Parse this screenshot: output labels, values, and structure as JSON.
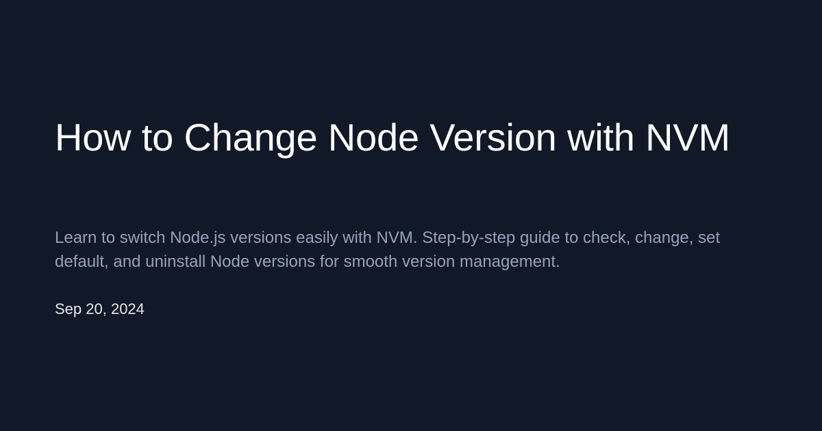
{
  "article": {
    "title": "How to Change Node Version with NVM",
    "description": "Learn to switch Node.js versions easily with NVM. Step-by-step guide to check, change, set default, and uninstall Node versions for smooth version management.",
    "date": "Sep 20, 2024"
  },
  "colors": {
    "background": "#111827",
    "title": "#ffffff",
    "description": "#94a3b8",
    "date": "#e5e7eb"
  }
}
